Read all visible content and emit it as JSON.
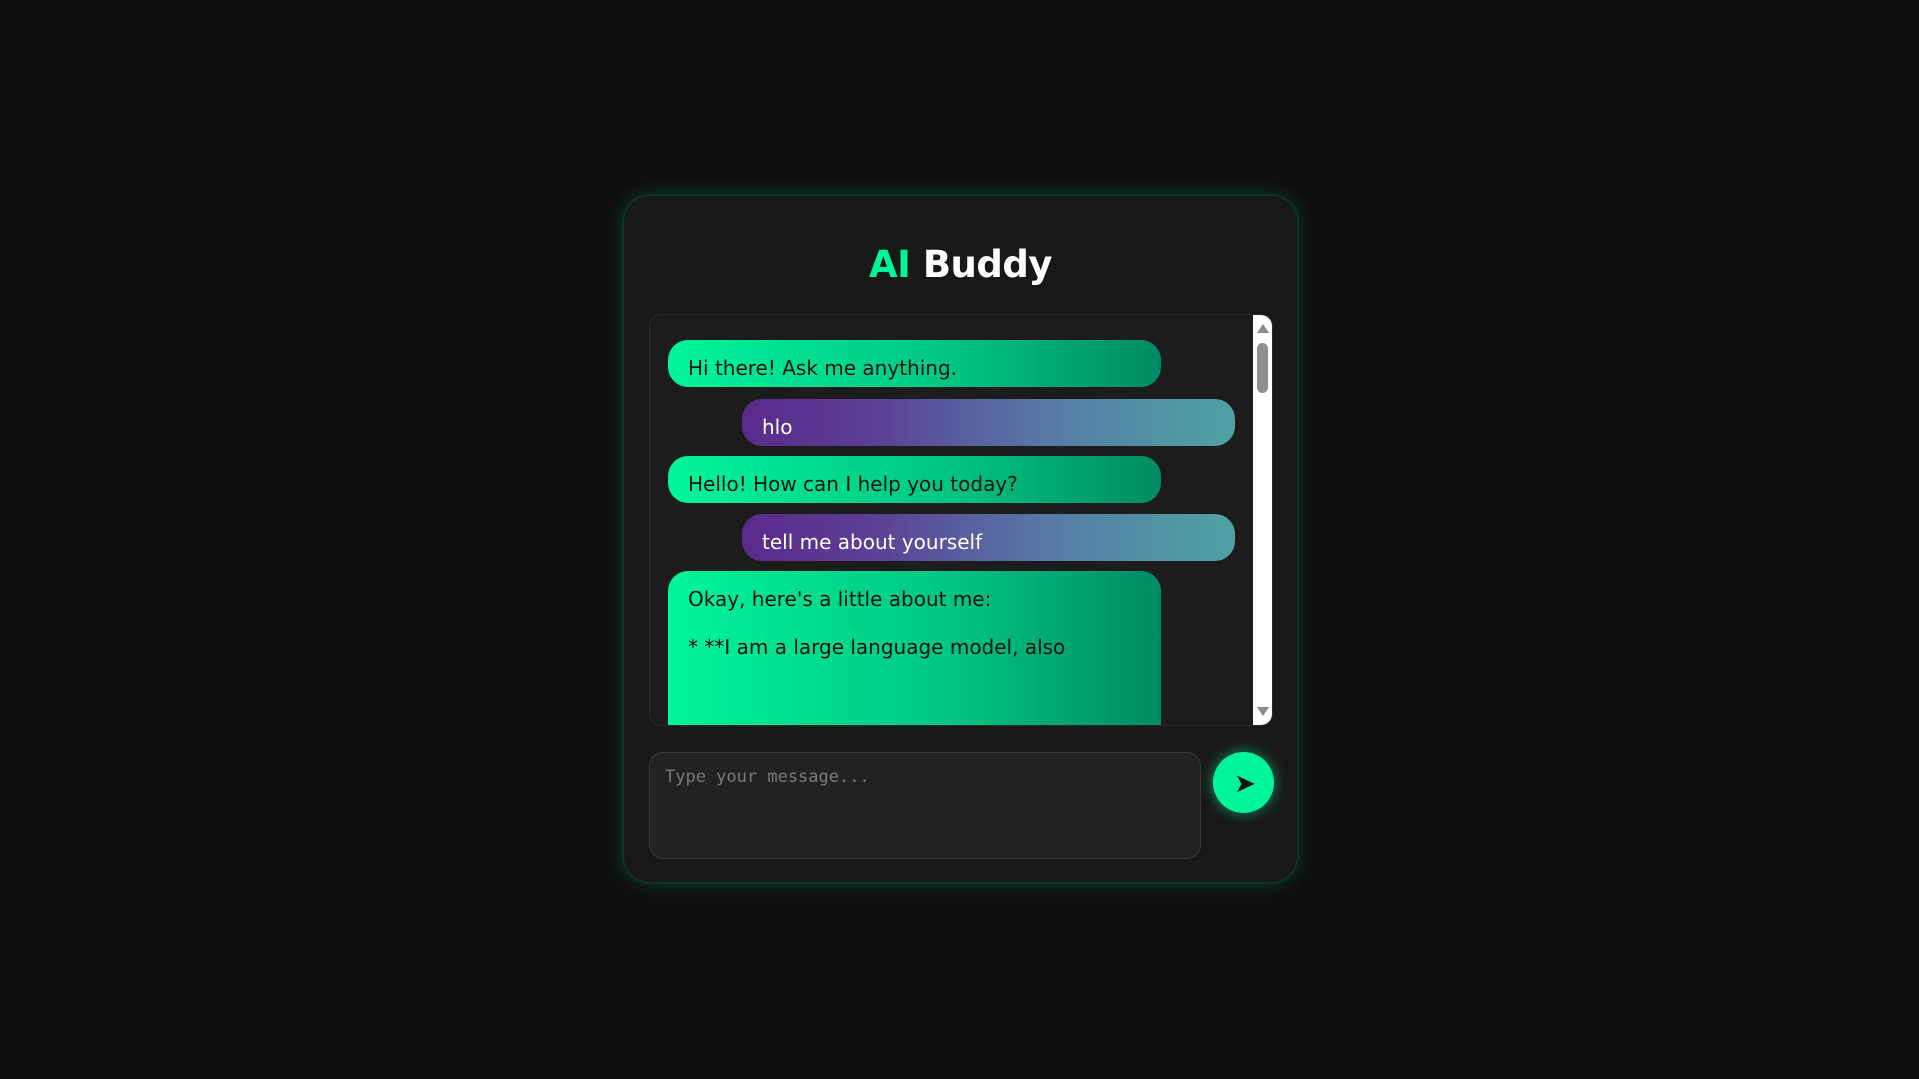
{
  "header": {
    "title_accent": "AI",
    "title_rest": " Buddy"
  },
  "chat": {
    "messages": [
      {
        "role": "bot",
        "text": "Hi there! Ask me anything."
      },
      {
        "role": "user",
        "text": "hlo"
      },
      {
        "role": "bot",
        "text": "Hello! How can I help you today?"
      },
      {
        "role": "user",
        "text": "tell me about yourself"
      },
      {
        "role": "bot",
        "text": "Okay, here's a little about me:\n\n* **I am a large language model, also"
      }
    ]
  },
  "composer": {
    "placeholder": "Type your message...",
    "value": "",
    "send_icon": "send-arrow-icon",
    "send_glyph": "➤"
  },
  "colors": {
    "accent": "#00f59a",
    "background": "#0e0e0e",
    "panel": "#181818",
    "user_bubble_start": "#5a2a8c",
    "user_bubble_end": "#4ea3a2"
  }
}
